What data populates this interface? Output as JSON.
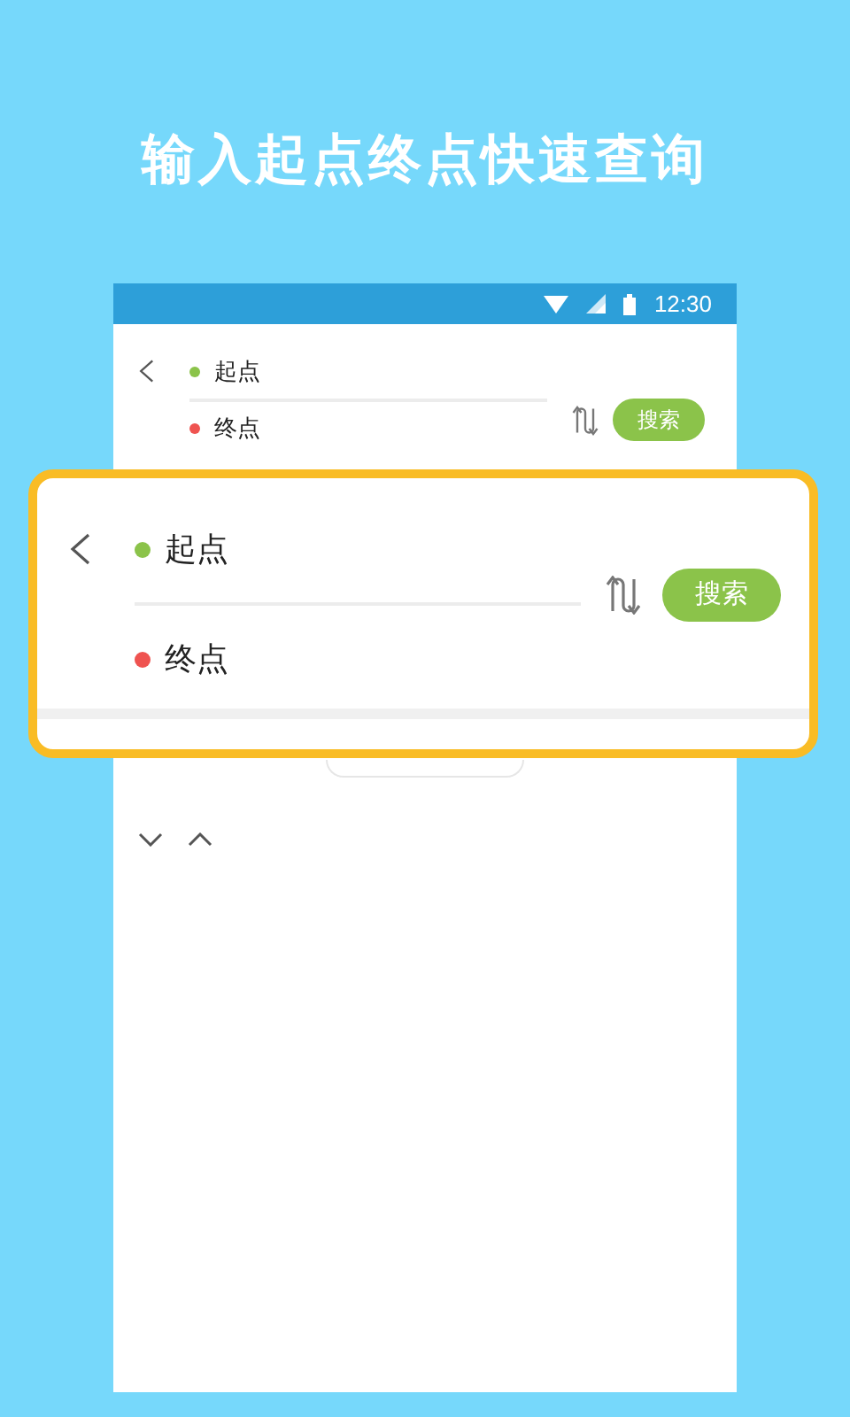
{
  "headline": "输入起点终点快速查询",
  "status_bar": {
    "time": "12:30"
  },
  "screen_form": {
    "start": "起点",
    "end": "终点",
    "search_button": "搜索"
  },
  "zoomed_form": {
    "start": "起点",
    "end": "终点",
    "search_button": "搜索"
  }
}
